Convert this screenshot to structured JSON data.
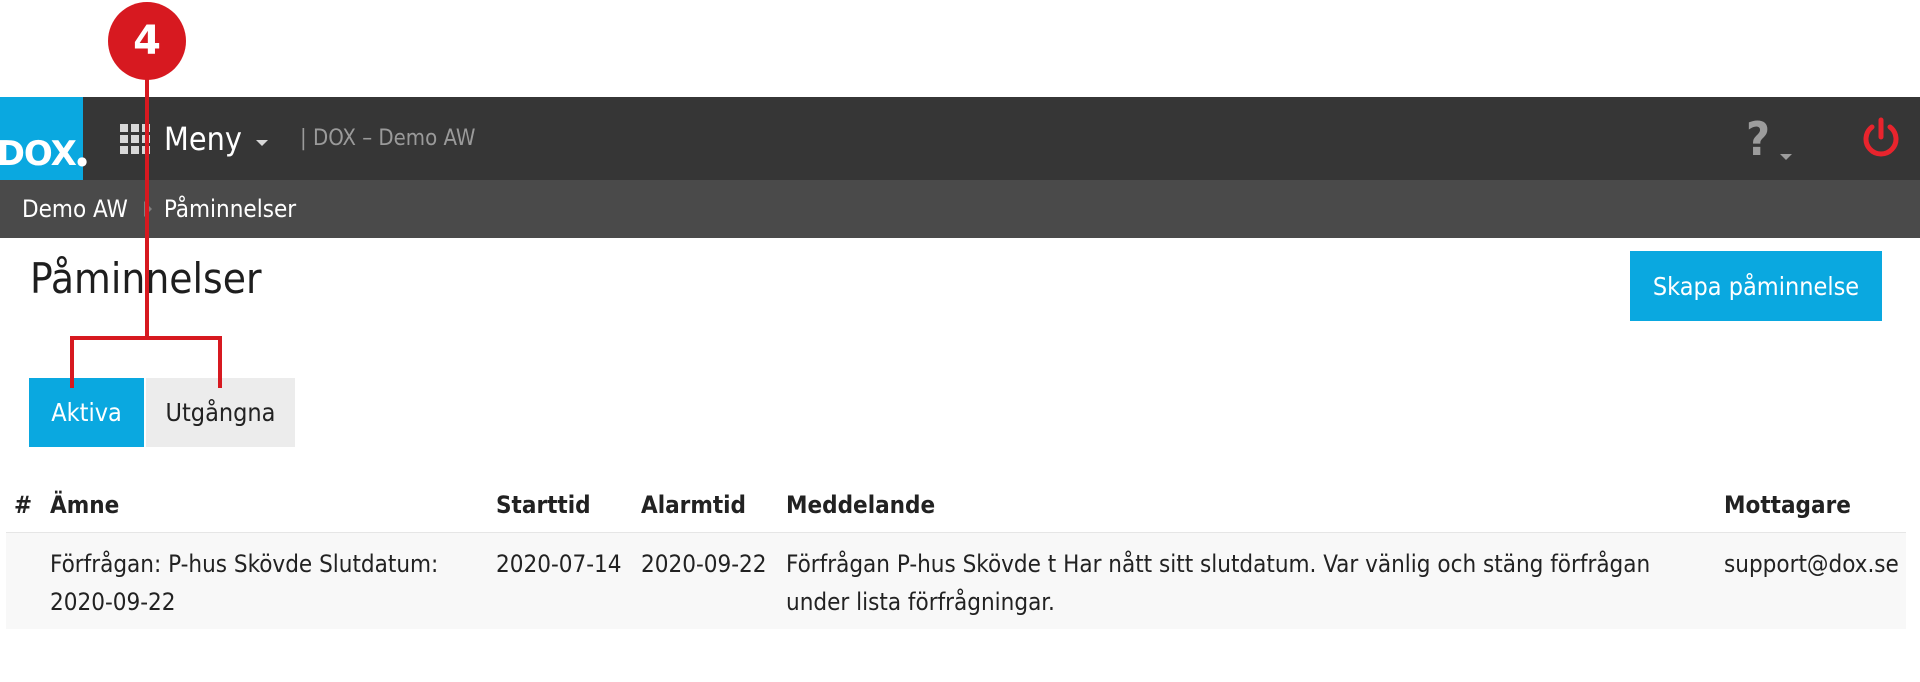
{
  "callout": {
    "number": "4"
  },
  "navbar": {
    "logo": "DOX",
    "menu_label": "Meny",
    "context": "| DOX – Demo AW",
    "help": "?"
  },
  "breadcrumb": {
    "items": [
      "Demo AW",
      "Påminnelser"
    ]
  },
  "page": {
    "title": "Påminnelser",
    "create_button": "Skapa påminnelse"
  },
  "tabs": [
    {
      "label": "Aktiva",
      "active": true
    },
    {
      "label": "Utgångna",
      "active": false
    }
  ],
  "table": {
    "headers": [
      "#",
      "Ämne",
      "Starttid",
      "Alarmtid",
      "Meddelande",
      "Mottagare"
    ],
    "rows": [
      {
        "subject": "Förfrågan: P-hus Skövde Slutdatum: 2020-09-22",
        "start": "2020-07-14",
        "alarm": "2020-09-22",
        "message": "Förfrågan P-hus Skövde t Har nått sitt slutdatum. Var vänlig och stäng förfrågan under lista förfrågningar.",
        "recipient": "support@dox.se"
      }
    ]
  },
  "colors": {
    "accent": "#0aa8e0",
    "navbar": "#363636",
    "breadcrumb": "#4a4a4a",
    "callout": "#d71920",
    "power": "#e8242d"
  }
}
